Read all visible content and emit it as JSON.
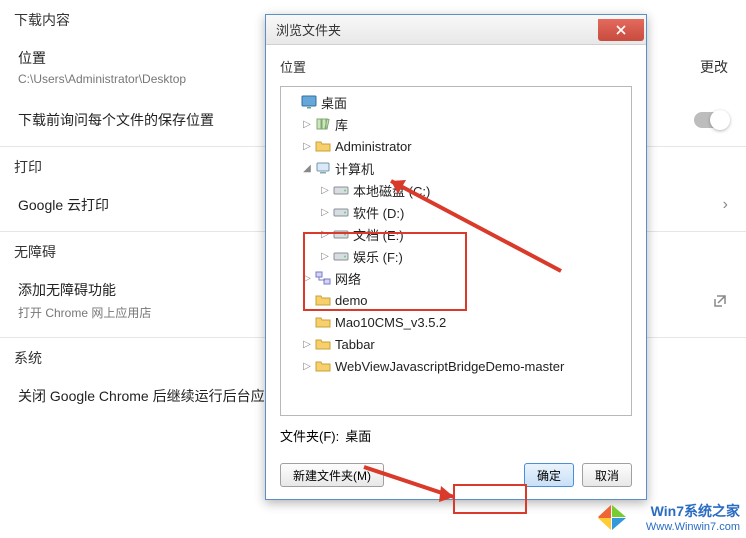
{
  "settings": {
    "download_header": "下载内容",
    "location_label": "位置",
    "location_path": "C:\\Users\\Administrator\\Desktop",
    "change_label": "更改",
    "ask_each_label": "下载前询问每个文件的保存位置",
    "print_header": "打印",
    "cloud_print_label": "Google 云打印",
    "a11y_header": "无障碍",
    "a11y_title": "添加无障碍功能",
    "a11y_sub": "打开 Chrome 网上应用店",
    "system_header": "系统",
    "system_row": "关闭 Google Chrome 后继续运行后台应"
  },
  "dialog": {
    "title": "浏览文件夹",
    "body_label": "位置",
    "folder_label": "文件夹(F):",
    "folder_value": "桌面",
    "new_folder_btn": "新建文件夹(M)",
    "ok_btn": "确定",
    "cancel_btn": "取消"
  },
  "tree": [
    {
      "lvl": 0,
      "exp": "",
      "icon": "desktop",
      "label": "桌面"
    },
    {
      "lvl": 1,
      "exp": "▷",
      "icon": "lib",
      "label": "库"
    },
    {
      "lvl": 1,
      "exp": "▷",
      "icon": "folder",
      "label": "Administrator"
    },
    {
      "lvl": 1,
      "exp": "◢",
      "icon": "computer",
      "label": "计算机"
    },
    {
      "lvl": 2,
      "exp": "▷",
      "icon": "drive",
      "label": "本地磁盘 (C:)"
    },
    {
      "lvl": 2,
      "exp": "▷",
      "icon": "drive",
      "label": "软件 (D:)"
    },
    {
      "lvl": 2,
      "exp": "▷",
      "icon": "drive",
      "label": "文档 (E:)"
    },
    {
      "lvl": 2,
      "exp": "▷",
      "icon": "drive",
      "label": "娱乐 (F:)"
    },
    {
      "lvl": 1,
      "exp": "▷",
      "icon": "net",
      "label": "网络"
    },
    {
      "lvl": 1,
      "exp": "",
      "icon": "folder",
      "label": "demo"
    },
    {
      "lvl": 1,
      "exp": "",
      "icon": "folder",
      "label": "Mao10CMS_v3.5.2"
    },
    {
      "lvl": 1,
      "exp": "▷",
      "icon": "folder",
      "label": "Tabbar"
    },
    {
      "lvl": 1,
      "exp": "▷",
      "icon": "folder",
      "label": "WebViewJavascriptBridgeDemo-master"
    }
  ],
  "watermark": {
    "zh": "Win7系统之家",
    "url": "Www.Winwin7.com"
  }
}
